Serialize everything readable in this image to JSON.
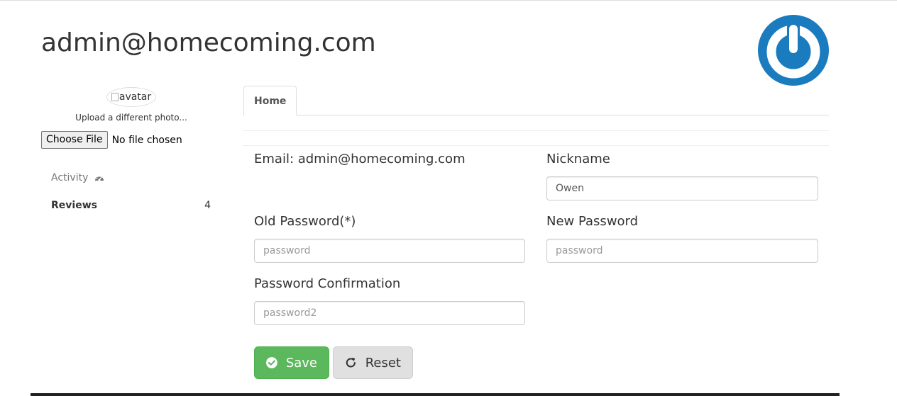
{
  "header": {
    "title": "admin@homecoming.com",
    "logo_icon": "power-icon",
    "logo_color": "#1b7bbf"
  },
  "sidebar": {
    "avatar_alt": "avatar",
    "upload_label": "Upload a different photo...",
    "file_button": "Choose File",
    "file_status": "No file chosen",
    "items": [
      {
        "label": "Activity",
        "icon": "dashboard-icon"
      },
      {
        "label": "Reviews",
        "count": "4"
      }
    ]
  },
  "tabs": [
    {
      "label": "Home",
      "active": true
    }
  ],
  "form": {
    "email_label": "Email: admin@homecoming.com",
    "nickname_label": "Nickname",
    "nickname_value": "Owen",
    "old_password_label": "Old Password(*)",
    "old_password_placeholder": "password",
    "new_password_label": "New Password",
    "new_password_placeholder": "password",
    "confirm_label": "Password Confirmation",
    "confirm_placeholder": "password2"
  },
  "buttons": {
    "save": "Save",
    "reset": "Reset",
    "save_color": "#5cb85c"
  }
}
